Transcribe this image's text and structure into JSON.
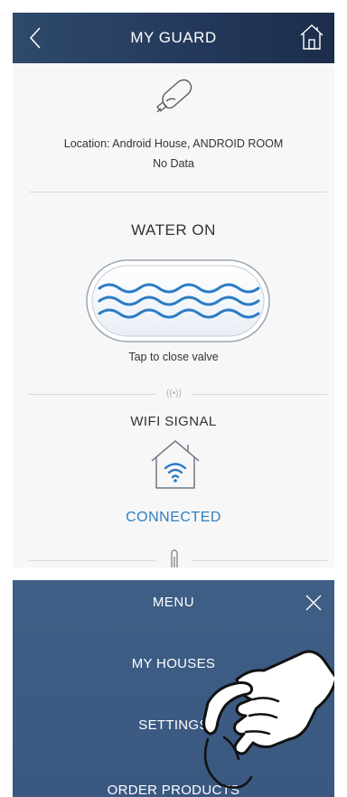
{
  "header": {
    "title": "MY GUARD",
    "back_icon": "chevron-left-icon",
    "home_icon": "home-icon"
  },
  "device": {
    "icon": "water-guard-device-icon",
    "location": "Location: Android House, ANDROID ROOM",
    "status": "No Data"
  },
  "water": {
    "title": "WATER ON",
    "valve_icon": "water-waves-icon",
    "hint": "Tap to close valve"
  },
  "wifi": {
    "small_label": "((•))",
    "title": "WIFI SIGNAL",
    "icon": "house-wifi-icon",
    "status": "CONNECTED"
  },
  "menu": {
    "title": "MENU",
    "close_icon": "close-icon",
    "items": [
      {
        "label": "MY HOUSES"
      },
      {
        "label": "SETTINGS"
      },
      {
        "label": "ORDER PRODUCTS"
      }
    ]
  },
  "colors": {
    "header_bg": "#23385a",
    "menu_bg": "#3f5f86",
    "accent_blue": "#2f7fc0",
    "wave_blue": "#2c7cc6"
  }
}
